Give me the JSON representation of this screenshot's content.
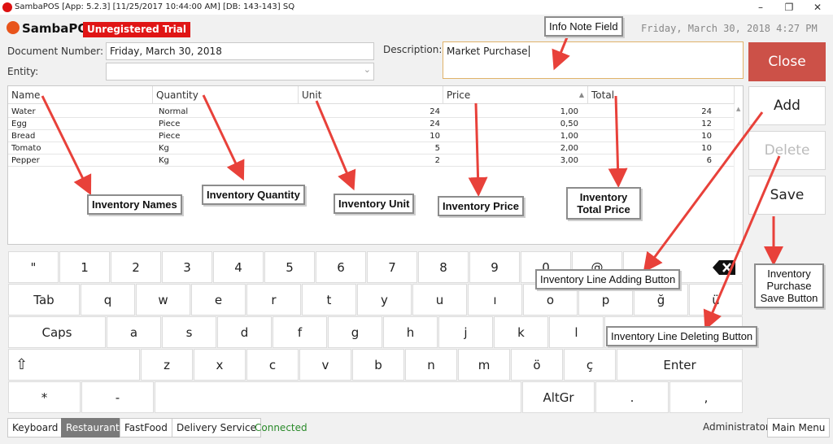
{
  "window": {
    "title": "SambaPOS [App: 5.2.3] [11/25/2017 10:44:00 AM] [DB: 143-143] SQ",
    "minimize": "–",
    "restore": "❐",
    "close": "✕"
  },
  "header": {
    "logo": "SambaPOS",
    "trial_badge": "Unregistered Trial",
    "clock": "Friday, March 30, 2018 4:27 PM"
  },
  "form": {
    "document_number_label": "Document Number:",
    "document_number_value": "Friday, March 30, 2018",
    "entity_label": "Entity:",
    "entity_value": "",
    "entity_dropdown": "⌄",
    "description_label": "Description:",
    "description_value": "Market Purchase"
  },
  "grid": {
    "columns": [
      "Name",
      "Quantity",
      "Unit",
      "Price",
      "Total"
    ],
    "rows": [
      {
        "name": "Water",
        "unit": "Normal",
        "quantity": "24",
        "price": "1,00",
        "total": "24"
      },
      {
        "name": "Egg",
        "unit": "Piece",
        "quantity": "24",
        "price": "0,50",
        "total": "12"
      },
      {
        "name": "Bread",
        "unit": "Piece",
        "quantity": "10",
        "price": "1,00",
        "total": "10"
      },
      {
        "name": "Tomato",
        "unit": "Kg",
        "quantity": "5",
        "price": "2,00",
        "total": "10"
      },
      {
        "name": "Pepper",
        "unit": "Kg",
        "quantity": "2",
        "price": "3,00",
        "total": "6"
      }
    ]
  },
  "side_buttons": {
    "close": "Close",
    "add": "Add",
    "delete": "Delete",
    "save": "Save"
  },
  "keyboard": {
    "row1": [
      "\"",
      "1",
      "2",
      "3",
      "4",
      "5",
      "6",
      "7",
      "8",
      "9",
      "0",
      "@"
    ],
    "row2": [
      "Tab",
      "q",
      "w",
      "e",
      "r",
      "t",
      "y",
      "u",
      "ı",
      "o",
      "p",
      "ğ",
      "ü"
    ],
    "row3": [
      "Caps",
      "a",
      "s",
      "d",
      "f",
      "g",
      "h",
      "j",
      "k",
      "l"
    ],
    "row4": [
      "⇧",
      "z",
      "x",
      "c",
      "v",
      "b",
      "n",
      "m",
      "ö",
      "ç",
      "Enter"
    ],
    "row5": [
      "*",
      "-",
      "",
      "AltGr",
      ".",
      ","
    ]
  },
  "annotations": {
    "info_note": "Info Note Field",
    "inventory_names": "Inventory Names",
    "inventory_quantity": "Inventory Quantity",
    "inventory_unit": "Inventory Unit",
    "inventory_price": "Inventory Price",
    "inventory_total_line1": "Inventory",
    "inventory_total_line2": "Total Price",
    "line_adding": "Inventory Line Adding Button",
    "line_deleting": "Inventory Line Deleting Button",
    "save_line1": "Inventory",
    "save_line2": "Purchase",
    "save_line3": "Save Button"
  },
  "statusbar": {
    "keyboard": "Keyboard",
    "restaurant": "Restaurant",
    "fastfood": "FastFood",
    "delivery": "Delivery Service",
    "connected": "Connected",
    "user": "Administrator",
    "main_menu": "Main Menu"
  },
  "colors": {
    "close_button": "#cc5148",
    "trial_badge": "#e01515",
    "connected": "#2a8a2a",
    "arrow": "#e8413a"
  }
}
